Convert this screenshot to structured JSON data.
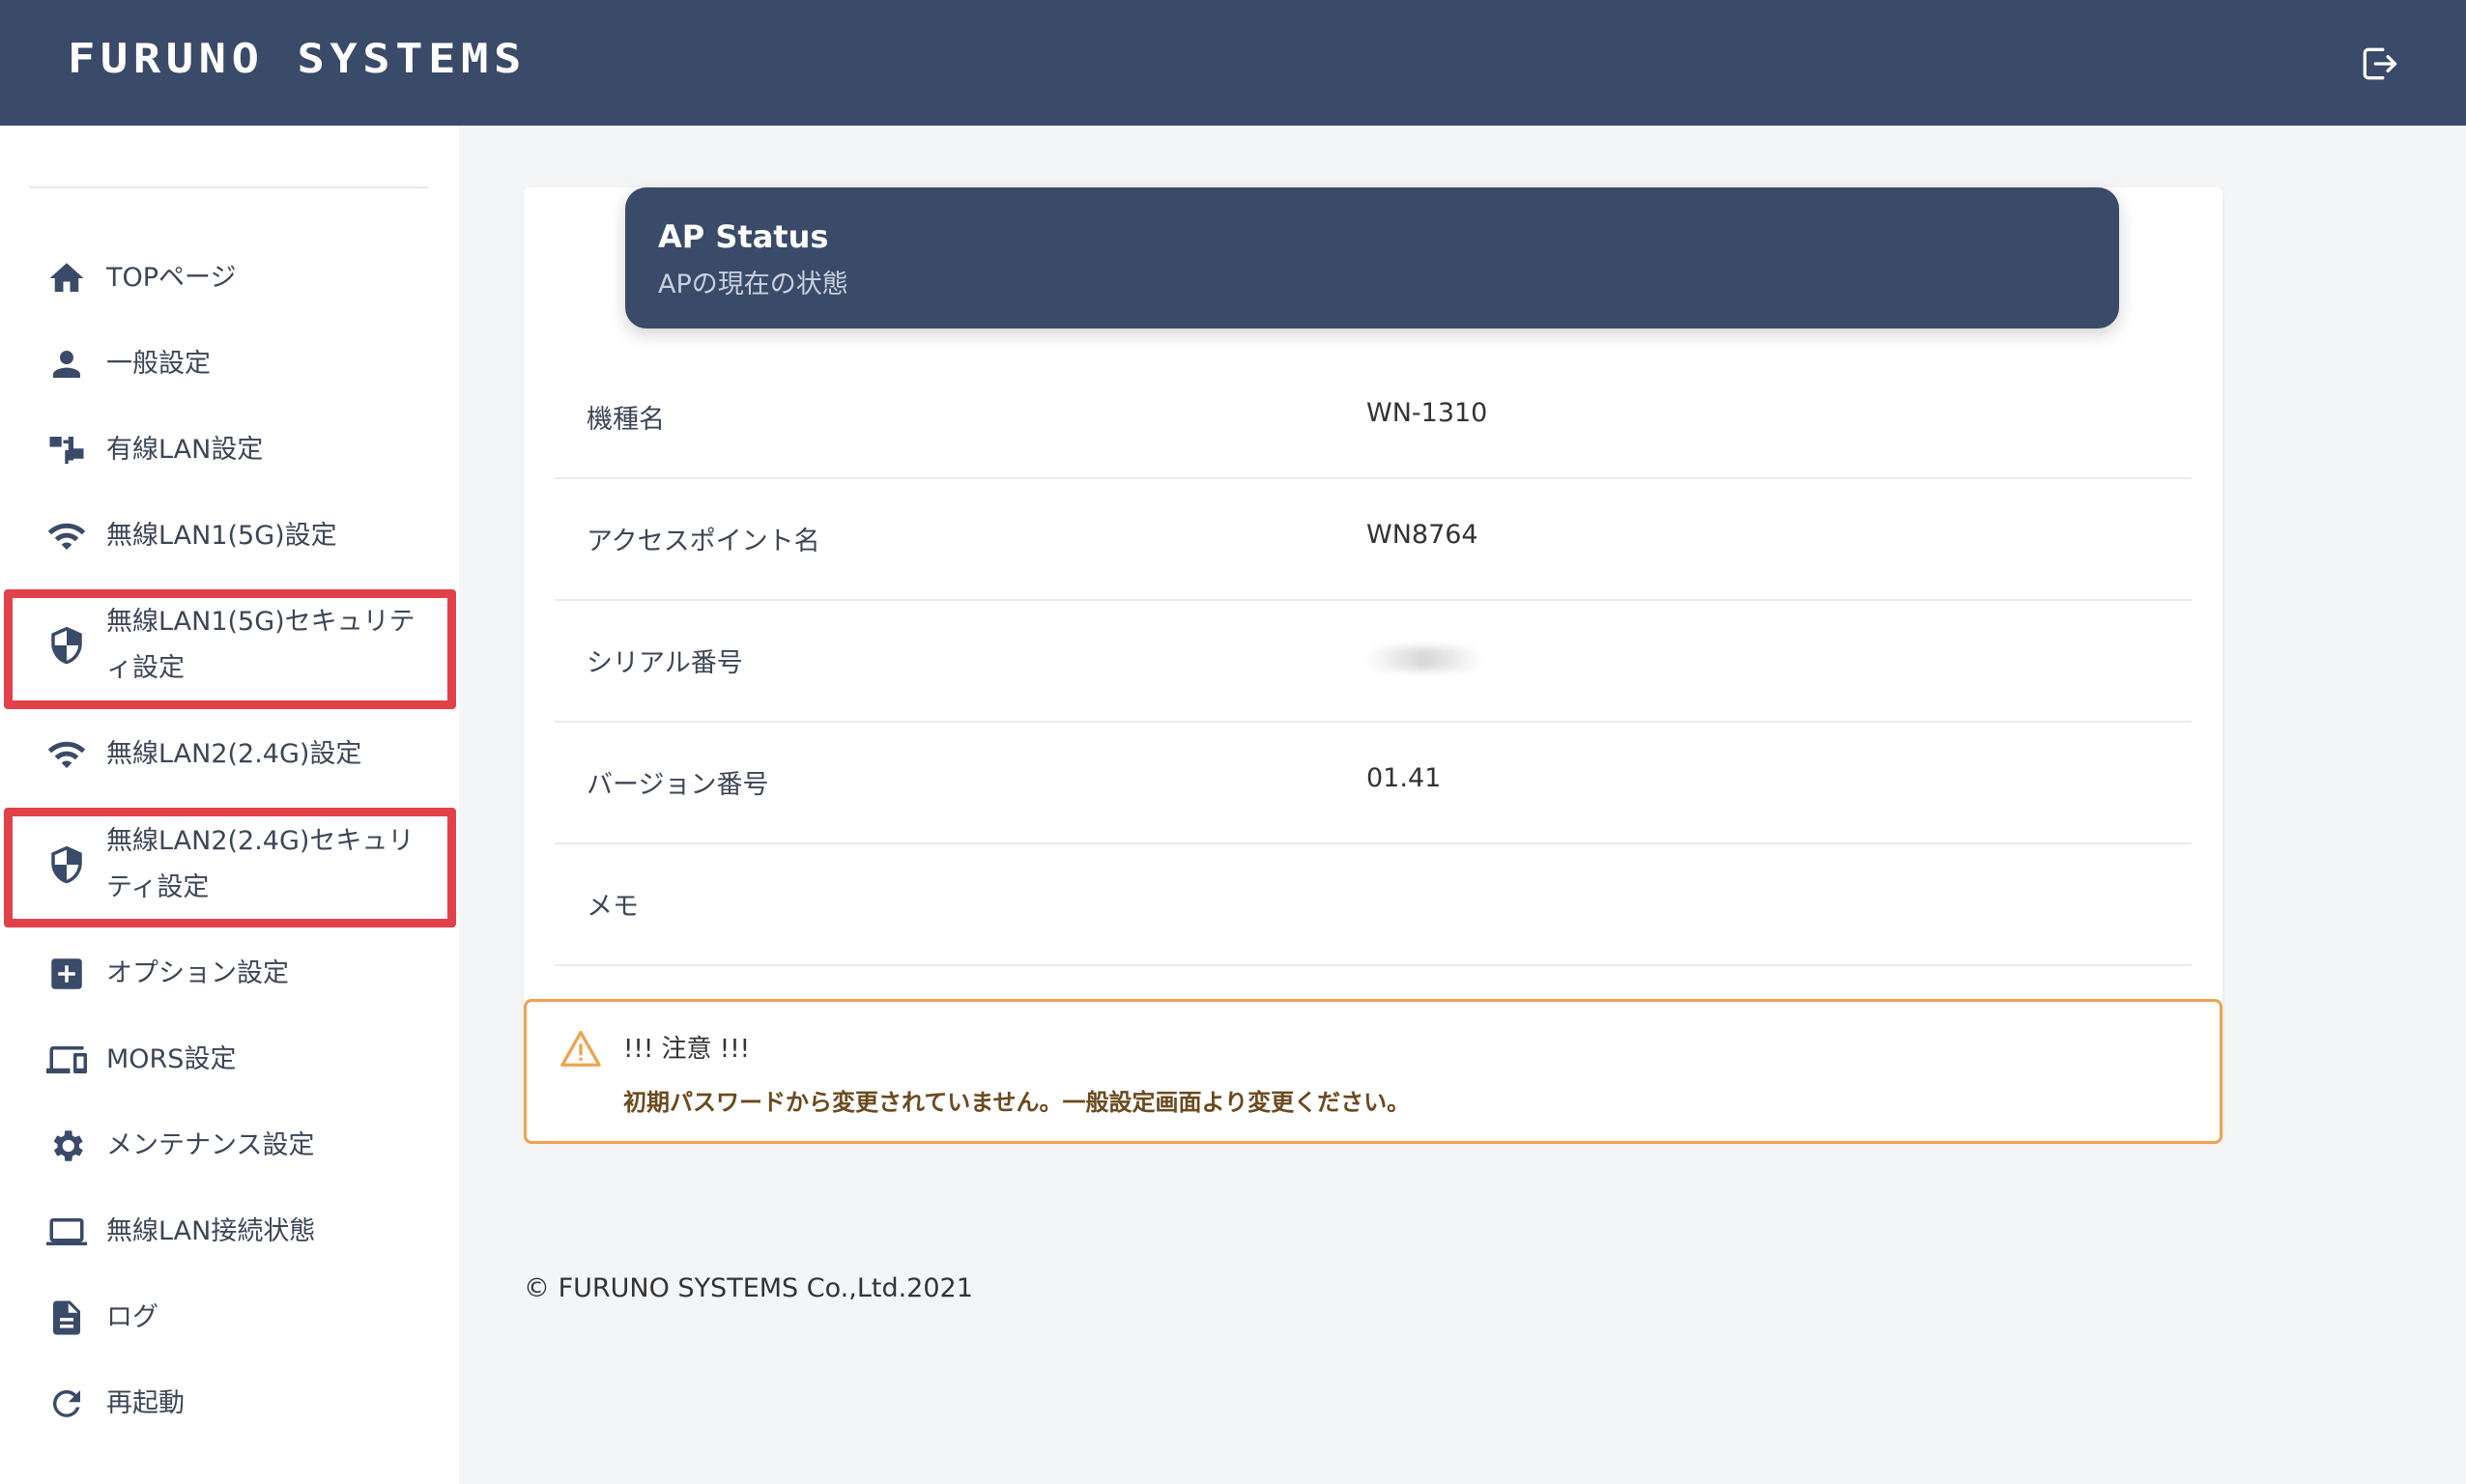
{
  "header": {
    "logo_text": "FURUNO SYSTEMS",
    "logout_icon": "logout-icon"
  },
  "sidebar": {
    "items": [
      {
        "label": "TOPページ",
        "icon": "home-icon"
      },
      {
        "label": "一般設定",
        "icon": "user-icon"
      },
      {
        "label": "有線LAN設定",
        "icon": "network-icon"
      },
      {
        "label": "無線LAN1(5G)設定",
        "icon": "wifi-icon"
      },
      {
        "label": "無線LAN1(5G)セキュリティ設定",
        "icon": "shield-icon",
        "highlighted": true
      },
      {
        "label": "無線LAN2(2.4G)設定",
        "icon": "wifi-icon"
      },
      {
        "label": "無線LAN2(2.4G)セキュリティ設定",
        "icon": "shield-icon",
        "highlighted": true
      },
      {
        "label": "オプション設定",
        "icon": "plus-box-icon"
      },
      {
        "label": "MORS設定",
        "icon": "devices-icon"
      },
      {
        "label": "メンテナンス設定",
        "icon": "gear-icon"
      },
      {
        "label": "無線LAN接続状態",
        "icon": "laptop-icon"
      },
      {
        "label": "ログ",
        "icon": "document-icon"
      },
      {
        "label": "再起動",
        "icon": "refresh-icon"
      }
    ]
  },
  "card": {
    "title": "AP Status",
    "subtitle": "APの現在の状態",
    "rows": [
      {
        "label": "機種名",
        "value": "WN-1310"
      },
      {
        "label": "アクセスポイント名",
        "value": "WN8764"
      },
      {
        "label": "シリアル番号",
        "value": ""
      },
      {
        "label": "バージョン番号",
        "value": "01.41"
      },
      {
        "label": "メモ",
        "value": ""
      }
    ]
  },
  "warning": {
    "title": "!!! 注意 !!!",
    "message": "初期パスワードから変更されていません。一般設定画面より変更ください。"
  },
  "footer": {
    "copyright": "© FURUNO SYSTEMS Co.,Ltd.2021"
  },
  "colors": {
    "header_bg": "#3a4a69",
    "highlight": "#e2414a",
    "warning_border": "#f0a24c"
  }
}
